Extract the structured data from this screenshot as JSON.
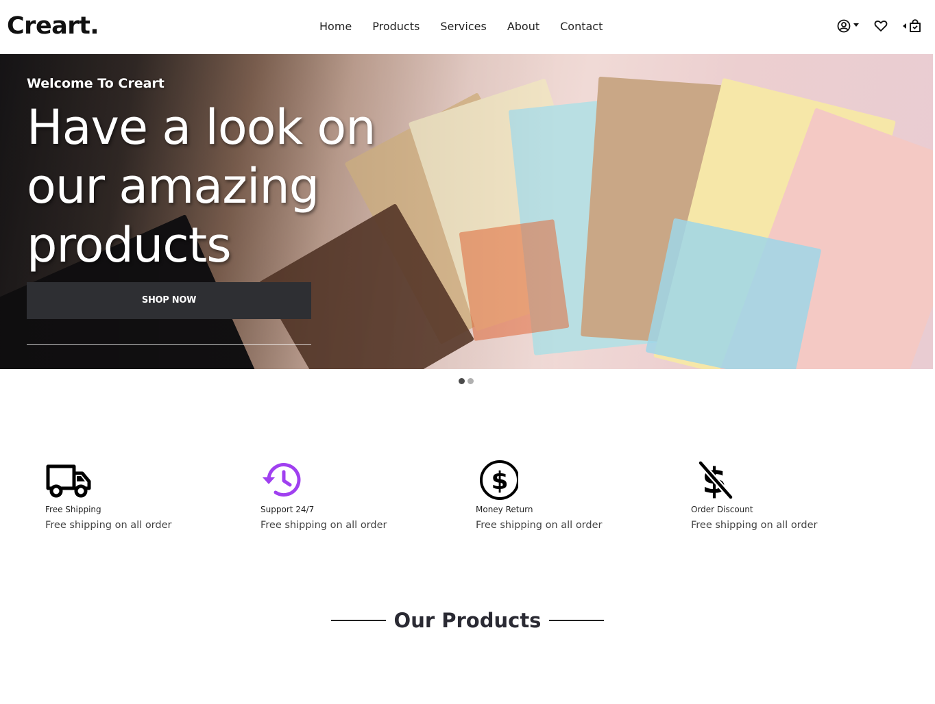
{
  "brand": {
    "logo": "Creart."
  },
  "nav": {
    "items": [
      "Home",
      "Products",
      "Services",
      "About",
      "Contact"
    ]
  },
  "header_icons": {
    "account": "user-circle-icon",
    "wishlist": "heart-icon",
    "cart": "shopping-bag-icon"
  },
  "hero": {
    "welcome": "Welcome To Creart",
    "headline": "Have a look on our amazing products",
    "cta": "SHOP NOW",
    "slides": 2,
    "active_slide": 1
  },
  "features": [
    {
      "icon": "truck-icon",
      "title": "Free Shipping",
      "desc": "Free shipping on all order",
      "color": "#000000"
    },
    {
      "icon": "history-icon",
      "title": "Support 24/7",
      "desc": "Free shipping on all order",
      "color": "#a040f0"
    },
    {
      "icon": "dollar-circle-icon",
      "title": "Money Return",
      "desc": "Free shipping on all order",
      "color": "#000000"
    },
    {
      "icon": "dollar-slash-icon",
      "title": "Order Discount",
      "desc": "Free shipping on all order",
      "color": "#000000"
    }
  ],
  "section": {
    "title": "Our Products"
  }
}
